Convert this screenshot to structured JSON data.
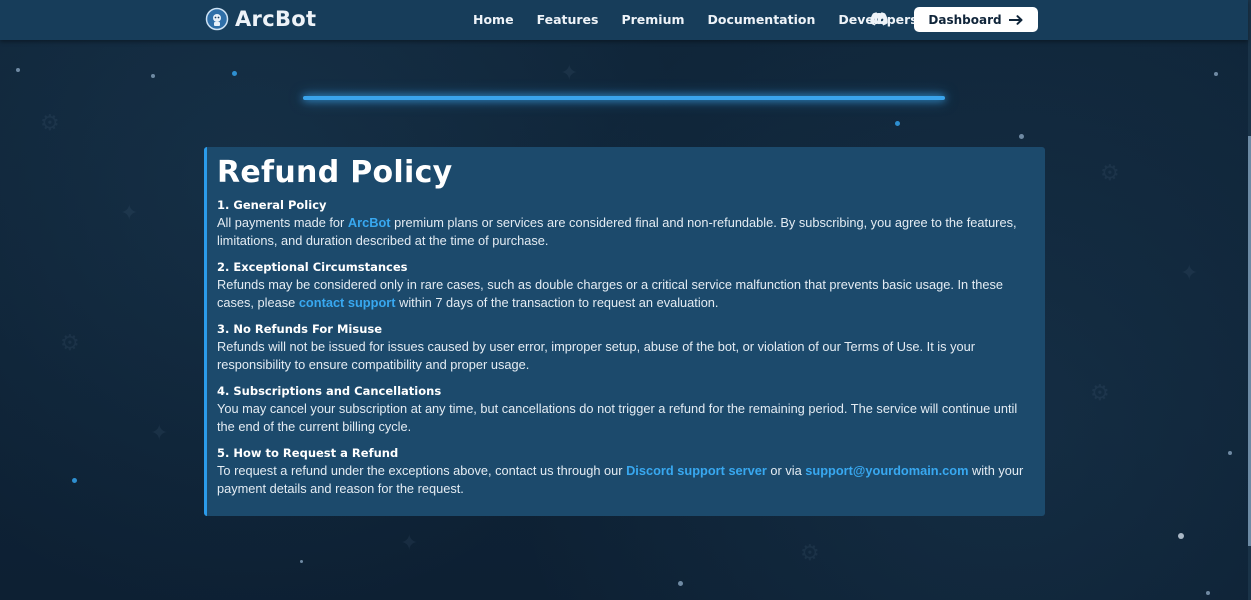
{
  "navbar": {
    "logo_icon": "robot-planet-icon",
    "brand": "ArcBot",
    "links": [
      "Home",
      "Features",
      "Premium",
      "Documentation",
      "Developers"
    ],
    "discord_icon": "discord-icon",
    "dashboard_label": "Dashboard",
    "dashboard_icon": "arrow-right-icon"
  },
  "colors": {
    "accent": "#38a8f0",
    "navbar": "#173d5a",
    "card": "#1c4a6c",
    "background": "#0e2235"
  },
  "page": {
    "title": "Refund Policy",
    "sections": [
      {
        "heading": "1. General Policy",
        "parts": {
          "a": "All payments made for ",
          "link1": "ArcBot",
          "b": " premium plans or services are considered final and non-refundable. By subscribing, you agree to the features, limitations, and duration described at the time of purchase."
        }
      },
      {
        "heading": "2. Exceptional Circumstances",
        "parts": {
          "a": "Refunds may be considered only in rare cases, such as double charges or a critical service malfunction that prevents basic usage. In these cases, please ",
          "link1": "contact support",
          "b": " within 7 days of the transaction to request an evaluation."
        }
      },
      {
        "heading": "3. No Refunds For Misuse",
        "text": "Refunds will not be issued for issues caused by user error, improper setup, abuse of the bot, or violation of our Terms of Use. It is your responsibility to ensure compatibility and proper usage."
      },
      {
        "heading": "4. Subscriptions and Cancellations",
        "text": "You may cancel your subscription at any time, but cancellations do not trigger a refund for the remaining period. The service will continue until the end of the current billing cycle."
      },
      {
        "heading": "5. How to Request a Refund",
        "parts": {
          "a": "To request a refund under the exceptions above, contact us through our ",
          "link1": "Discord support server",
          "b": " or via ",
          "link2": "support@yourdomain.com",
          "c": " with your payment details and reason for the request."
        }
      }
    ]
  }
}
